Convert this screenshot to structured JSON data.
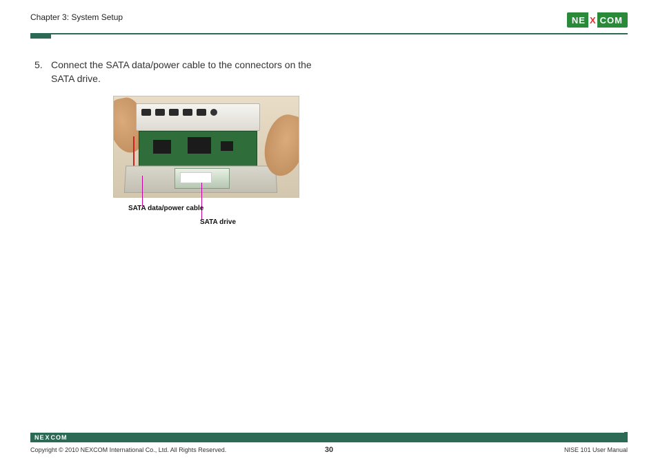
{
  "header": {
    "chapter_title": "Chapter 3: System Setup",
    "brand_left": "NE",
    "brand_x": "X",
    "brand_right": "COM"
  },
  "step": {
    "number": "5.",
    "text": "Connect the SATA data/power cable to the connectors on the SATA drive."
  },
  "callouts": {
    "cable": "SATA data/power cable",
    "drive": "SATA drive"
  },
  "footer": {
    "brand_left": "NE",
    "brand_x": "X",
    "brand_right": "COM",
    "copyright": "Copyright © 2010 NEXCOM International Co., Ltd. All Rights Reserved.",
    "page_number": "30",
    "doc_title": "NISE 101 User Manual"
  }
}
